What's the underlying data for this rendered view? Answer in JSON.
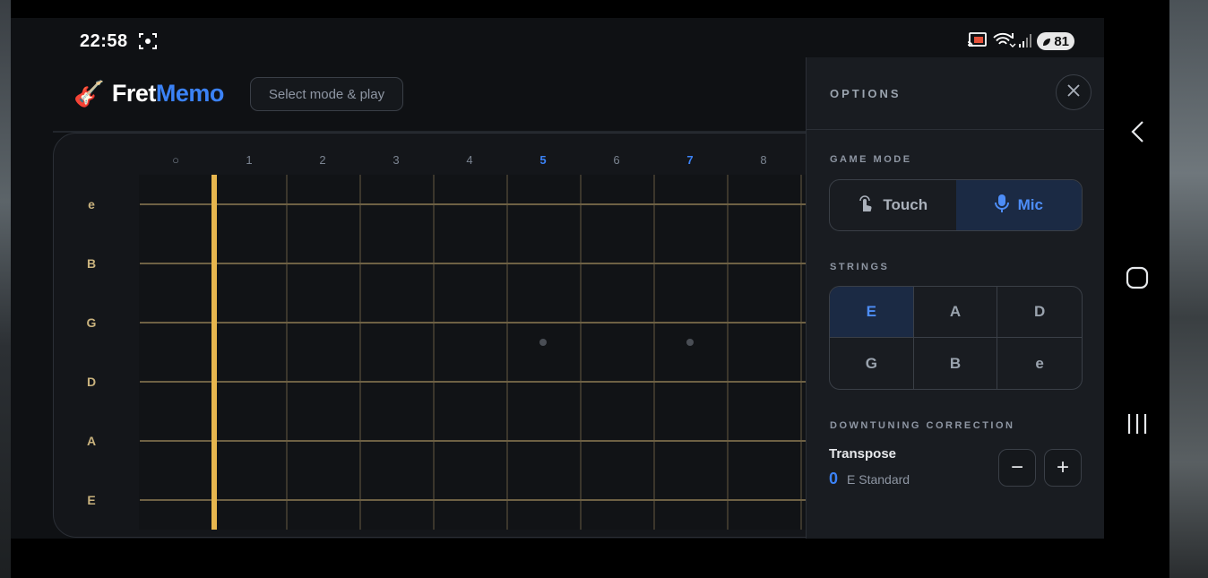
{
  "status_bar": {
    "time": "22:58",
    "battery": "81"
  },
  "header": {
    "logo_icon": "guitar-emoji",
    "logo_emoji": "🎸",
    "brand_part1": "Fret",
    "brand_part2": "Memo",
    "mode_button": "Select mode & play"
  },
  "fretboard": {
    "fret_numbers": [
      "○",
      "1",
      "2",
      "3",
      "4",
      "5",
      "6",
      "7",
      "8"
    ],
    "marked_frets": [
      "5",
      "7"
    ],
    "strings": [
      "e",
      "B",
      "G",
      "D",
      "A",
      "E"
    ]
  },
  "options": {
    "title": "OPTIONS",
    "game_mode_label": "GAME MODE",
    "modes": [
      {
        "label": "Touch",
        "active": false
      },
      {
        "label": "Mic",
        "active": true
      }
    ],
    "strings_label": "STRINGS",
    "strings": [
      {
        "label": "E",
        "active": true
      },
      {
        "label": "A",
        "active": false
      },
      {
        "label": "D",
        "active": false
      },
      {
        "label": "G",
        "active": false
      },
      {
        "label": "B",
        "active": false
      },
      {
        "label": "e",
        "active": false
      }
    ],
    "downtuning_label": "DOWNTUNING CORRECTION",
    "transpose_label": "Transpose",
    "transpose_value": "0",
    "tuning_name": "E Standard",
    "minus": "−",
    "plus": "+"
  },
  "colors": {
    "accent": "#3b82f6",
    "nut": "#e7b64e",
    "string_label": "#c9b27d"
  }
}
